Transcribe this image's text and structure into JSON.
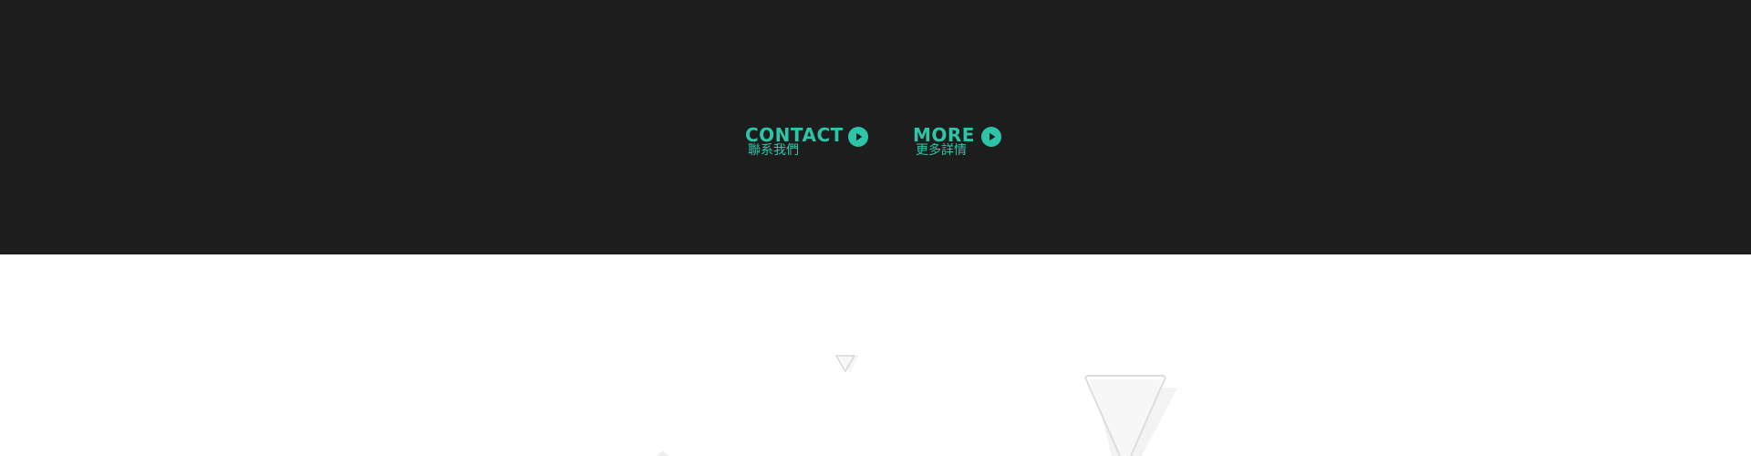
{
  "actions": {
    "contact": {
      "title": "CONTACT",
      "subtitle": "聯系我們",
      "icon": "play-circle-icon"
    },
    "more": {
      "title": "MORE",
      "subtitle": "更多詳情",
      "icon": "play-circle-icon"
    }
  },
  "colors": {
    "dark_background": "#1d1d1d",
    "accent": "#2dc5a8",
    "light_background": "#ffffff",
    "decor_outline": "#d8d8d8",
    "decor_fill": "#f4f4f4"
  }
}
